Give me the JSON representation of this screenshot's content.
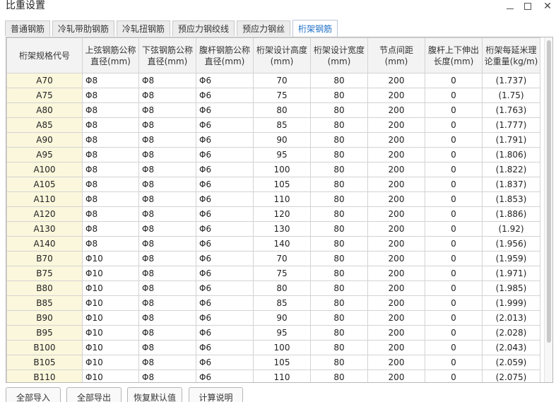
{
  "window": {
    "title": "比重设置"
  },
  "tabs": [
    {
      "label": "普通钢筋",
      "active": false
    },
    {
      "label": "冷轧带肋钢筋",
      "active": false
    },
    {
      "label": "冷轧扭钢筋",
      "active": false
    },
    {
      "label": "预应力钢绞线",
      "active": false
    },
    {
      "label": "预应力钢丝",
      "active": false
    },
    {
      "label": "桁架钢筋",
      "active": true
    }
  ],
  "table": {
    "headers": [
      "桁架规格代号",
      "上弦钢筋公称直径(mm)",
      "下弦钢筋公称直径(mm)",
      "腹杆钢筋公称直径(mm)",
      "桁架设计高度(mm)",
      "桁架设计宽度(mm)",
      "节点间距(mm)",
      "腹杆上下伸出长度(mm)",
      "桁架每延米理论重量(kg/m)"
    ],
    "rows": [
      [
        "A70",
        "Φ8",
        "Φ8",
        "Φ6",
        "70",
        "80",
        "200",
        "0",
        "(1.737)"
      ],
      [
        "A75",
        "Φ8",
        "Φ8",
        "Φ6",
        "75",
        "80",
        "200",
        "0",
        "(1.75)"
      ],
      [
        "A80",
        "Φ8",
        "Φ8",
        "Φ6",
        "80",
        "80",
        "200",
        "0",
        "(1.763)"
      ],
      [
        "A85",
        "Φ8",
        "Φ8",
        "Φ6",
        "85",
        "80",
        "200",
        "0",
        "(1.777)"
      ],
      [
        "A90",
        "Φ8",
        "Φ8",
        "Φ6",
        "90",
        "80",
        "200",
        "0",
        "(1.791)"
      ],
      [
        "A95",
        "Φ8",
        "Φ8",
        "Φ6",
        "95",
        "80",
        "200",
        "0",
        "(1.806)"
      ],
      [
        "A100",
        "Φ8",
        "Φ8",
        "Φ6",
        "100",
        "80",
        "200",
        "0",
        "(1.822)"
      ],
      [
        "A105",
        "Φ8",
        "Φ8",
        "Φ6",
        "105",
        "80",
        "200",
        "0",
        "(1.837)"
      ],
      [
        "A110",
        "Φ8",
        "Φ8",
        "Φ6",
        "110",
        "80",
        "200",
        "0",
        "(1.853)"
      ],
      [
        "A120",
        "Φ8",
        "Φ8",
        "Φ6",
        "120",
        "80",
        "200",
        "0",
        "(1.886)"
      ],
      [
        "A130",
        "Φ8",
        "Φ8",
        "Φ6",
        "130",
        "80",
        "200",
        "0",
        "(1.92)"
      ],
      [
        "A140",
        "Φ8",
        "Φ8",
        "Φ6",
        "140",
        "80",
        "200",
        "0",
        "(1.956)"
      ],
      [
        "B70",
        "Φ10",
        "Φ8",
        "Φ6",
        "70",
        "80",
        "200",
        "0",
        "(1.959)"
      ],
      [
        "B75",
        "Φ10",
        "Φ8",
        "Φ6",
        "75",
        "80",
        "200",
        "0",
        "(1.971)"
      ],
      [
        "B80",
        "Φ10",
        "Φ8",
        "Φ6",
        "80",
        "80",
        "200",
        "0",
        "(1.985)"
      ],
      [
        "B85",
        "Φ10",
        "Φ8",
        "Φ6",
        "85",
        "80",
        "200",
        "0",
        "(1.999)"
      ],
      [
        "B90",
        "Φ10",
        "Φ8",
        "Φ6",
        "90",
        "80",
        "200",
        "0",
        "(2.013)"
      ],
      [
        "B95",
        "Φ10",
        "Φ8",
        "Φ6",
        "95",
        "80",
        "200",
        "0",
        "(2.028)"
      ],
      [
        "B100",
        "Φ10",
        "Φ8",
        "Φ6",
        "100",
        "80",
        "200",
        "0",
        "(2.043)"
      ],
      [
        "B105",
        "Φ10",
        "Φ8",
        "Φ6",
        "105",
        "80",
        "200",
        "0",
        "(2.059)"
      ],
      [
        "B110",
        "Φ10",
        "Φ8",
        "Φ6",
        "110",
        "80",
        "200",
        "0",
        "(2.075)"
      ]
    ]
  },
  "buttons": {
    "import_all": "全部导入",
    "export_all": "全部导出",
    "restore_defaults": "恢复默认值",
    "calc_explain": "计算说明"
  },
  "colors": {
    "active_tab_text": "#1e6fc8",
    "code_cell_bg": "#fbf7dc",
    "header_bg": "#f3f3f3"
  }
}
